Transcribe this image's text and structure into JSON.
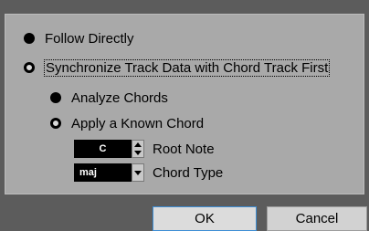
{
  "options": {
    "follow_directly": "Follow Directly",
    "synchronize": "Synchronize Track Data with Chord Track First"
  },
  "sub_options": {
    "analyze_chords": "Analyze Chords",
    "apply_known_chord": "Apply a Known Chord"
  },
  "root_note": {
    "value": "C",
    "label": "Root Note"
  },
  "chord_type": {
    "value": "maj",
    "label": "Chord Type"
  },
  "buttons": {
    "ok": "OK",
    "cancel": "Cancel"
  }
}
